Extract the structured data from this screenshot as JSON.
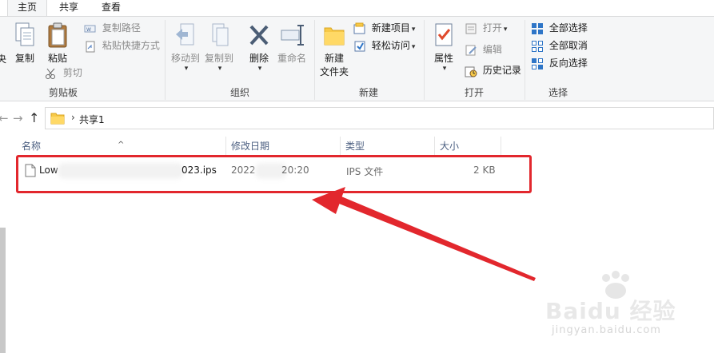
{
  "tabs": {
    "home": "主页",
    "share": "共享",
    "view": "查看"
  },
  "clipboard": {
    "group_label": "剪贴板",
    "cut_partial": "央",
    "copy": "复制",
    "paste": "粘贴",
    "copy_path": "复制路径",
    "paste_shortcut": "粘贴快捷方式",
    "cut": "剪切"
  },
  "organize": {
    "group_label": "组织",
    "move_to": "移动到",
    "copy_to": "复制到",
    "delete": "删除",
    "rename": "重命名"
  },
  "new": {
    "group_label": "新建",
    "new_folder_line1": "新建",
    "new_folder_line2": "文件夹",
    "new_item": "新建项目",
    "easy_access": "轻松访问"
  },
  "open": {
    "group_label": "打开",
    "properties": "属性",
    "open": "打开",
    "edit": "编辑",
    "history": "历史记录"
  },
  "select": {
    "group_label": "选择",
    "select_all": "全部选择",
    "select_none": "全部取消",
    "invert": "反向选择"
  },
  "address": {
    "path": "共享1"
  },
  "columns": {
    "name": "名称",
    "modified": "修改日期",
    "type": "类型",
    "size": "大小"
  },
  "files": [
    {
      "name_start": "Low",
      "name_end": "023.ips",
      "date_start": "2022",
      "date_end": "20:20",
      "type": "IPS 文件",
      "size": "2 KB"
    }
  ],
  "watermark": {
    "brand": "Baidu 经验",
    "url": "jingyan.baidu.com"
  },
  "colors": {
    "highlight": "#e2272d",
    "accent": "#1e6fbf"
  }
}
